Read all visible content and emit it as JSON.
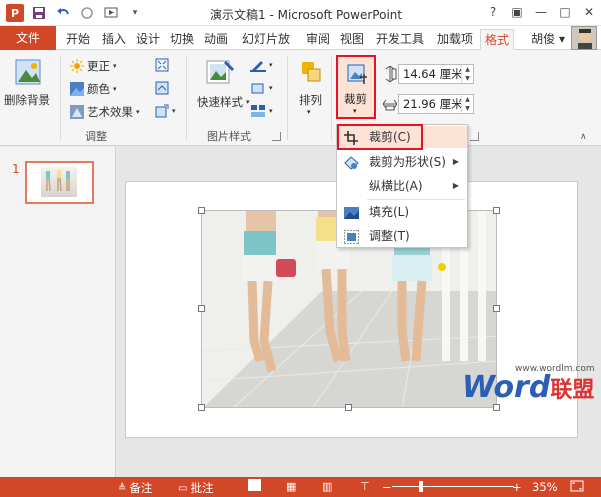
{
  "window": {
    "title": "演示文稿1 - Microsoft PowerPoint",
    "app_icon": "P",
    "controls": [
      "?",
      "▣",
      "—",
      "□",
      "✕"
    ]
  },
  "tabs": [
    {
      "label": "文件",
      "kind": "file"
    },
    {
      "label": "开始"
    },
    {
      "label": "插入"
    },
    {
      "label": "设计"
    },
    {
      "label": "切换"
    },
    {
      "label": "动画"
    },
    {
      "label": "幻灯片放"
    },
    {
      "label": "审阅"
    },
    {
      "label": "视图"
    },
    {
      "label": "开发工具"
    },
    {
      "label": "加载项"
    },
    {
      "label": "格式",
      "active": true
    }
  ],
  "user": {
    "name": "胡俊 ▾"
  },
  "ribbon": {
    "remove_bg": "删除背景",
    "adjust": {
      "corrections": "更正",
      "color": "颜色",
      "artistic": "艺术效果",
      "group_label": "调整"
    },
    "picture_styles": {
      "quick_styles": "快速样式",
      "group_label": "图片样式"
    },
    "arrange": "排列",
    "crop": "裁剪",
    "size": {
      "height": "14.64 厘米",
      "width": "21.96 厘米"
    }
  },
  "crop_menu": {
    "items": [
      {
        "label": "裁剪(C)",
        "icon": "crop-icon"
      },
      {
        "label": "裁剪为形状(S)",
        "icon": "shape-icon",
        "submenu": true
      },
      {
        "label": "纵横比(A)",
        "submenu": true
      },
      {
        "label": "填充(L)",
        "icon": "fill-icon"
      },
      {
        "label": "调整(T)",
        "icon": "fit-icon"
      }
    ]
  },
  "slides_pane": {
    "slide_number": "1"
  },
  "watermark": {
    "brand_en": "Word",
    "brand_cn": "联盟",
    "url": "www.wordlm.com"
  },
  "status": {
    "notes": "备注",
    "comments": "批注",
    "zoom": "35%",
    "zoom_value": 0.35
  },
  "colors": {
    "accent": "#d24726",
    "highlight": "#e81123"
  }
}
